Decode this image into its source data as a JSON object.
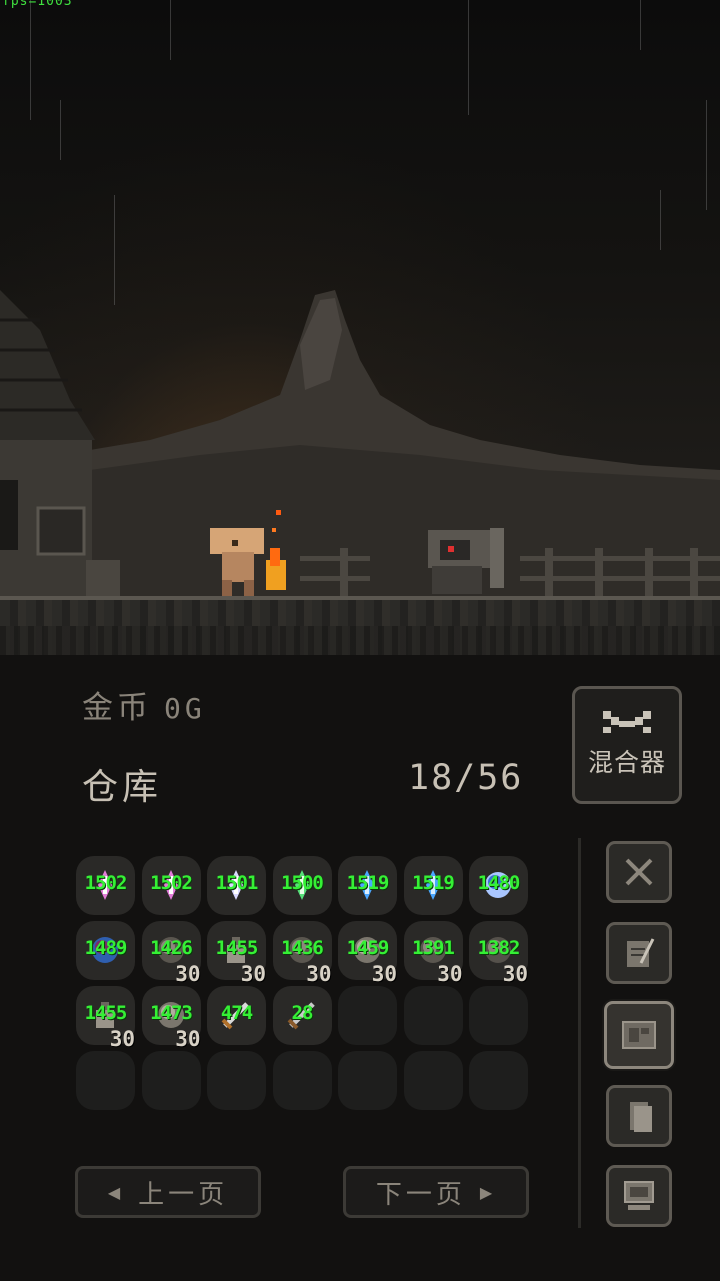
{
  "debug_text": "fps=1003",
  "gold": {
    "label": "金币",
    "value": "0G"
  },
  "mixer": {
    "label": "混合器",
    "icon": "crossed-tools-icon"
  },
  "storage": {
    "title": "仓库",
    "count": "18/56"
  },
  "inventory": [
    {
      "num": "1502",
      "qty": "",
      "icon": "pink-crystal"
    },
    {
      "num": "1502",
      "qty": "",
      "icon": "pink-crystal"
    },
    {
      "num": "1501",
      "qty": "",
      "icon": "white-crystal"
    },
    {
      "num": "1500",
      "qty": "",
      "icon": "green-crystal"
    },
    {
      "num": "1519",
      "qty": "",
      "icon": "blue-crystal"
    },
    {
      "num": "1519",
      "qty": "",
      "icon": "blue-crystal"
    },
    {
      "num": "1480",
      "qty": "",
      "icon": "blue-orbs"
    },
    {
      "num": "1489",
      "qty": "",
      "icon": "dark-orb"
    },
    {
      "num": "1426",
      "qty": "30",
      "icon": "grey-ore"
    },
    {
      "num": "1455",
      "qty": "30",
      "icon": "potion-bottle"
    },
    {
      "num": "1436",
      "qty": "30",
      "icon": "grey-ore"
    },
    {
      "num": "1459",
      "qty": "30",
      "icon": "scroll"
    },
    {
      "num": "1391",
      "qty": "30",
      "icon": "grey-ore"
    },
    {
      "num": "1382",
      "qty": "30",
      "icon": "spiky-ore"
    },
    {
      "num": "1455",
      "qty": "30",
      "icon": "potion-bottle"
    },
    {
      "num": "1473",
      "qty": "30",
      "icon": "scroll"
    },
    {
      "num": "474",
      "qty": "",
      "icon": "sword"
    },
    {
      "num": "28",
      "qty": "",
      "icon": "dagger"
    },
    {
      "num": "",
      "qty": "",
      "icon": ""
    },
    {
      "num": "",
      "qty": "",
      "icon": ""
    },
    {
      "num": "",
      "qty": "",
      "icon": ""
    },
    {
      "num": "",
      "qty": "",
      "icon": ""
    },
    {
      "num": "",
      "qty": "",
      "icon": ""
    },
    {
      "num": "",
      "qty": "",
      "icon": ""
    },
    {
      "num": "",
      "qty": "",
      "icon": ""
    },
    {
      "num": "",
      "qty": "",
      "icon": ""
    },
    {
      "num": "",
      "qty": "",
      "icon": ""
    },
    {
      "num": "",
      "qty": "",
      "icon": ""
    }
  ],
  "pagination": {
    "prev_label": "上一页",
    "next_label": "下一页"
  },
  "side_menu": [
    {
      "icon": "crossed-swords-icon",
      "active": false
    },
    {
      "icon": "quill-scroll-icon",
      "active": false
    },
    {
      "icon": "map-icon",
      "active": true
    },
    {
      "icon": "document-icon",
      "active": false
    },
    {
      "icon": "computer-icon",
      "active": false
    }
  ],
  "colors": {
    "count_green": "#35f035",
    "panel_bg": "#121110",
    "border": "#5a5650"
  }
}
